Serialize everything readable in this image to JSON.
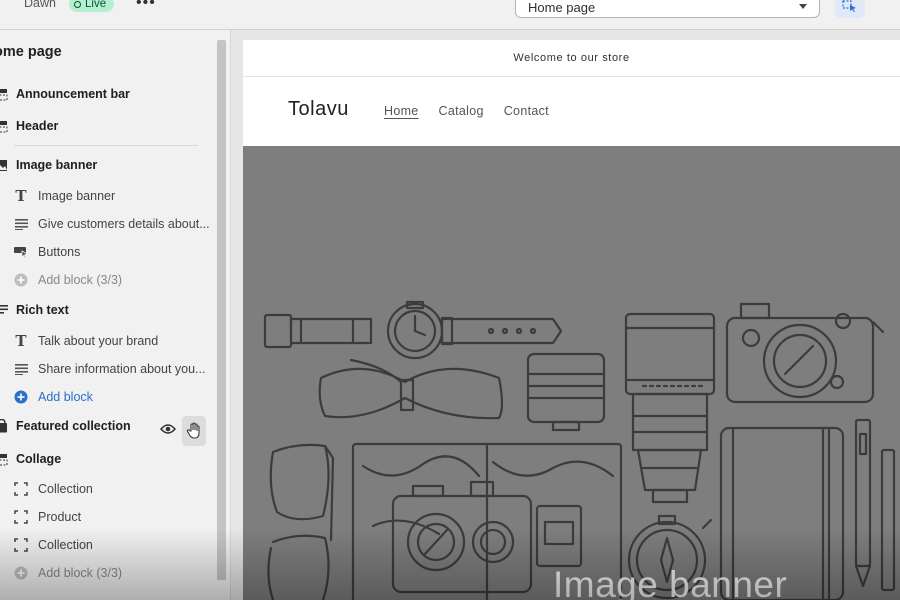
{
  "topbar": {
    "theme_name": "Dawn",
    "status_badge": "Live",
    "more_label": "•••",
    "page_select_value": "Home page"
  },
  "sidebar": {
    "title": "ome page",
    "sections": [
      {
        "label": "Announcement bar"
      },
      {
        "label": "Header"
      },
      {
        "label": "Image banner"
      },
      {
        "label": "Rich text"
      },
      {
        "label": "Featured collection"
      },
      {
        "label": "Collage"
      }
    ],
    "image_banner_blocks": [
      "Image banner",
      "Give customers details about...",
      "Buttons",
      "Add block (3/3)"
    ],
    "rich_text_blocks": [
      "Talk about your brand",
      "Share information about you...",
      "Add block"
    ],
    "collage_blocks": [
      "Collection",
      "Product",
      "Collection",
      "Add block (3/3)"
    ]
  },
  "preview": {
    "announcement": "Welcome to our store",
    "store_name": "Tolavu",
    "nav": [
      "Home",
      "Catalog",
      "Contact"
    ],
    "banner_title": "Image banner"
  },
  "colors": {
    "live_badge_bg": "#b4f0cf",
    "accent_blue": "#2c6ecb",
    "banner_bg": "#7e7e7e"
  },
  "icons": [
    "announcement-icon",
    "header-icon",
    "image-icon",
    "text-icon",
    "paragraph-icon",
    "buttons-icon",
    "plus-circle-icon",
    "tag-icon",
    "eye-icon",
    "hand-icon",
    "collage-item-icon",
    "chevron-down-icon",
    "inspector-icon"
  ]
}
